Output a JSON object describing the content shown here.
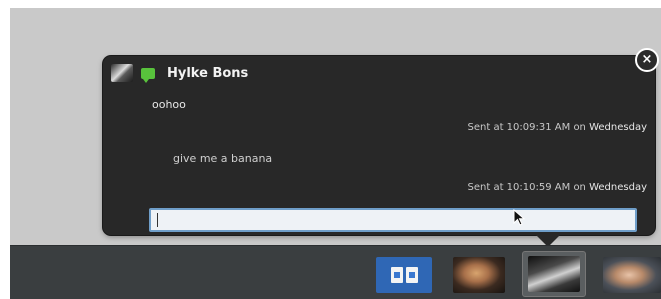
{
  "chat": {
    "contact_name": "Hylke Bons",
    "close_label": "×",
    "messages": [
      {
        "text": "oohoo",
        "time": "Sent at 10:09:31 AM",
        "on": "on",
        "day": "Wednesday"
      },
      {
        "text": "give me a banana",
        "time": "Sent at 10:10:59 AM",
        "on": "on",
        "day": "Wednesday"
      }
    ],
    "input": {
      "value": "",
      "placeholder": ""
    }
  },
  "panel": {
    "items": [
      {
        "name": "documents-launcher",
        "icon": "documents-icon"
      },
      {
        "name": "contact-avatar-1",
        "icon": "contact-avatar"
      },
      {
        "name": "contact-avatar-selected",
        "icon": "contact-avatar"
      },
      {
        "name": "contact-avatar-2",
        "icon": "contact-avatar"
      }
    ]
  },
  "colors": {
    "popup_bg": "#282828",
    "desktop_bg": "#c9c9c9",
    "panel_bg": "#3a3e40",
    "input_border": "#6f9ec9",
    "status_available": "#58c23c"
  }
}
